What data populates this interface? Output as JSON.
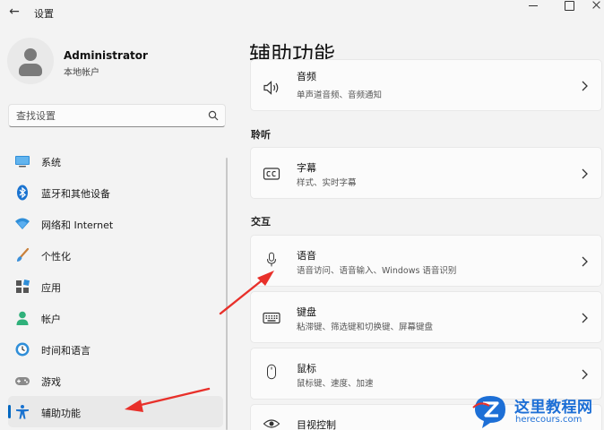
{
  "window": {
    "title": "设置",
    "back_glyph": "←"
  },
  "profile": {
    "name": "Administrator",
    "account_type": "本地帐户"
  },
  "search": {
    "placeholder": "查找设置"
  },
  "sidebar": {
    "items": [
      {
        "label": "系统",
        "icon": "system-monitor-icon"
      },
      {
        "label": "蓝牙和其他设备",
        "icon": "bluetooth-icon"
      },
      {
        "label": "网络和 Internet",
        "icon": "wifi-icon"
      },
      {
        "label": "个性化",
        "icon": "paintbrush-icon"
      },
      {
        "label": "应用",
        "icon": "apps-icon"
      },
      {
        "label": "帐户",
        "icon": "person-icon"
      },
      {
        "label": "时间和语言",
        "icon": "clock-globe-icon"
      },
      {
        "label": "游戏",
        "icon": "gamepad-icon"
      },
      {
        "label": "辅助功能",
        "icon": "accessibility-icon",
        "selected": true
      }
    ]
  },
  "main": {
    "title": "辅助功能",
    "sections": {
      "hearing": "聆听",
      "interaction": "交互"
    },
    "cards": {
      "audio": {
        "title": "音频",
        "desc": "单声道音频、音频通知",
        "icon": "speaker-icon"
      },
      "captions": {
        "title": "字幕",
        "desc": "样式、实时字幕",
        "icon": "closed-captions-icon"
      },
      "speech": {
        "title": "语音",
        "desc": "语音访问、语音输入、Windows 语音识别",
        "icon": "microphone-icon"
      },
      "keyboard": {
        "title": "键盘",
        "desc": "粘滞键、筛选键和切换键、屏幕键盘",
        "icon": "keyboard-icon"
      },
      "mouse": {
        "title": "鼠标",
        "desc": "鼠标键、速度、加速",
        "icon": "mouse-icon"
      },
      "eye_control": {
        "title": "目视控制",
        "icon": "eye-icon"
      }
    }
  },
  "colors": {
    "accent": "#0067c0",
    "annotation_arrow": "#e8302a",
    "watermark": "#1d6fd6"
  },
  "watermark": {
    "title": "这里教程网",
    "url": "herecours.com"
  }
}
